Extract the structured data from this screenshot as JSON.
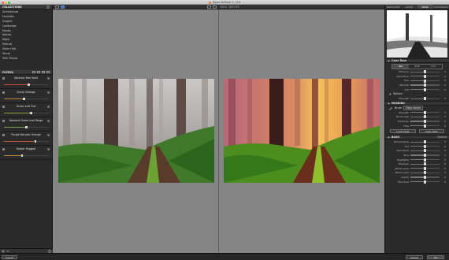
{
  "window": {
    "title": "Topaz ReMask 5 | 6.6",
    "close_color": "#ff5f57",
    "min_color": "#febc2e",
    "max_color": "#28c840"
  },
  "left_panel": {
    "collections_title": "COLLECTIONS",
    "collections": [
      "Architecture",
      "Favorites",
      "Graphic",
      "Landscape",
      "Moody",
      "Nature",
      "Night",
      "Portrait",
      "Silver Hills",
      "Street",
      "Tech Trends"
    ],
    "filters_title": "FILTERS",
    "filters": [
      {
        "name": "Abstract Red Sand",
        "fill": 0.55,
        "color": "#c94a2d"
      },
      {
        "name": "Dusty Vintage",
        "fill": 0.45,
        "color": "#b6893a"
      },
      {
        "name": "Green and Tint",
        "fill": 0.6,
        "color": "#8e9e3a"
      },
      {
        "name": "Abstract Green and Stage",
        "fill": 0.5,
        "color": "#7d9e4e"
      },
      {
        "name": "Purple Harvest Orange",
        "fill": 0.7,
        "color": "#b45c2e"
      },
      {
        "name": "Amber Rugged",
        "fill": 0.4,
        "color": "#c0803a"
      }
    ],
    "footer_icons": [
      "plus-icon",
      "minus-icon",
      "gear-icon"
    ]
  },
  "toolbar": {
    "zoom_label": "100%",
    "view_label": "BEFORE"
  },
  "right_panel": {
    "tabs": [
      "NAVIGATOR",
      "LOOKS",
      "MASK",
      "HISTOGRAM"
    ],
    "active_tab": 2,
    "sections": {
      "color_heading": "Color Tone",
      "seg_options": [
        "HSL",
        "RGB",
        "CMY"
      ],
      "color_sliders": [
        {
          "label": "Vibrance",
          "value": "0",
          "pos": 0.5
        },
        {
          "label": "Saturation",
          "value": "0",
          "pos": 0.5
        },
        {
          "label": "Hue",
          "value": "0",
          "pos": 0.5
        },
        {
          "label": "Warmth",
          "value": "0",
          "pos": 0.5
        },
        {
          "label": "Tint",
          "value": "0",
          "pos": 0.5
        }
      ],
      "texture_heading": "Texture",
      "texture_slider": {
        "label": "Strength",
        "value": "0",
        "pos": 0.5
      },
      "masking_heading": "MASKING",
      "brush_label": "Brush",
      "brush_mode": "Edge Aware",
      "brush_sliders": [
        {
          "label": "Strength",
          "value": "0",
          "pos": 0.5
        },
        {
          "label": "Brush Size",
          "value": "0",
          "pos": 0.5
        },
        {
          "label": "Hardness",
          "value": "0",
          "pos": 0.5
        },
        {
          "label": "Flow",
          "value": "0",
          "pos": 0.5
        }
      ],
      "btn_left": "Invert Mask",
      "btn_right": "Clear Mask",
      "basic_heading": "BASIC",
      "basic_preset": "Default",
      "basic_sliders": [
        {
          "label": "Temperature",
          "value": "0",
          "pos": 0.5
        },
        {
          "label": "Tint",
          "value": "0",
          "pos": 0.5
        },
        {
          "label": "Saturation",
          "value": "0",
          "pos": 0.5
        },
        {
          "label": "Tone",
          "value": "0",
          "pos": 0.5
        },
        {
          "label": "Highlights",
          "value": "0",
          "pos": 0.5
        },
        {
          "label": "Shadows",
          "value": "0",
          "pos": 0.5
        },
        {
          "label": "White Level",
          "value": "0",
          "pos": 0.5
        },
        {
          "label": "Black Level",
          "value": "0",
          "pos": 0.5
        },
        {
          "label": "Clarity",
          "value": "0",
          "pos": 0.5
        },
        {
          "label": "Structure",
          "value": "0",
          "pos": 0.5
        }
      ]
    }
  },
  "bottom_bar": {
    "left_button": "Cancel",
    "mid_button": "Cancel",
    "right_button": "OK"
  }
}
